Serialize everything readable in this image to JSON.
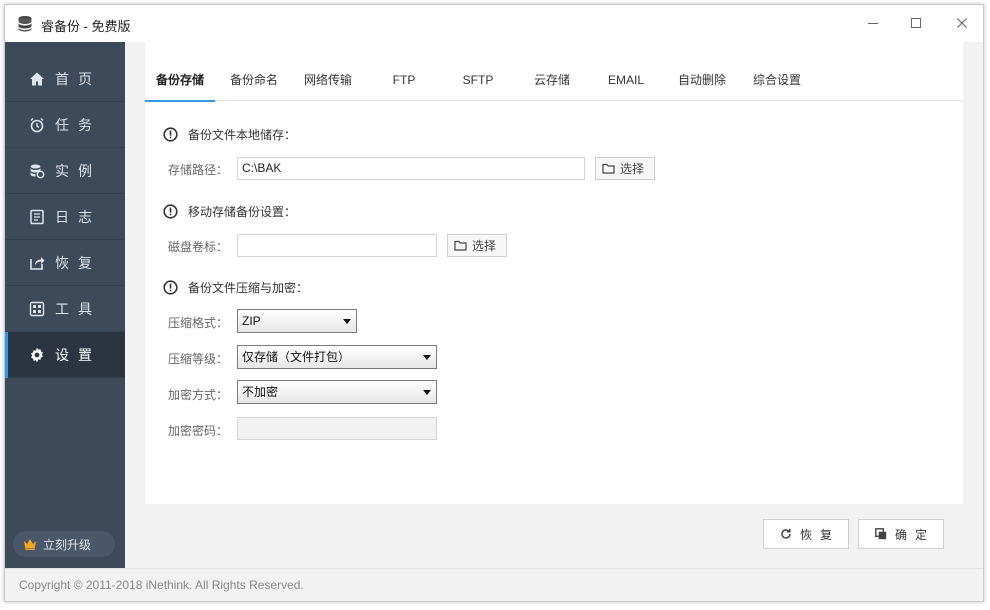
{
  "window": {
    "title": "睿备份 - 免费版"
  },
  "sidebar": {
    "items": [
      {
        "label": "首页",
        "icon": "home-icon"
      },
      {
        "label": "任务",
        "icon": "clock-icon"
      },
      {
        "label": "实例",
        "icon": "database-icon"
      },
      {
        "label": "日志",
        "icon": "log-icon"
      },
      {
        "label": "恢复",
        "icon": "restore-icon"
      },
      {
        "label": "工具",
        "icon": "tools-icon"
      },
      {
        "label": "设置",
        "icon": "gear-icon"
      }
    ],
    "active_index": 6,
    "upgrade_label": "立刻升级"
  },
  "tabs": [
    "备份存储",
    "备份命名",
    "网络传输",
    "FTP",
    "SFTP",
    "云存储",
    "EMAIL",
    "自动删除",
    "综合设置"
  ],
  "sections": {
    "local": {
      "title": "备份文件本地储存：",
      "path_label": "存储路径：",
      "path_value": "C:\\BAK",
      "browse_label": "选择"
    },
    "mobile": {
      "title": "移动存储备份设置：",
      "volume_label": "磁盘卷标：",
      "volume_value": "",
      "browse_label": "选择"
    },
    "compress": {
      "title": "备份文件压缩与加密：",
      "format_label": "压缩格式：",
      "format_value": "ZIP",
      "level_label": "压缩等级：",
      "level_value": "仅存储（文件打包）",
      "encrypt_label": "加密方式：",
      "encrypt_value": "不加密",
      "password_label": "加密密码：",
      "password_value": ""
    }
  },
  "actions": {
    "restore_label": "恢复",
    "confirm_label": "确定"
  },
  "footer": {
    "copyright": "Copyright © 2011-2018 iNethink. All Rights Reserved."
  },
  "colors": {
    "sidebar_bg": "#3d4a5a",
    "sidebar_active": "#2b3542",
    "accent": "#2e9be6"
  }
}
